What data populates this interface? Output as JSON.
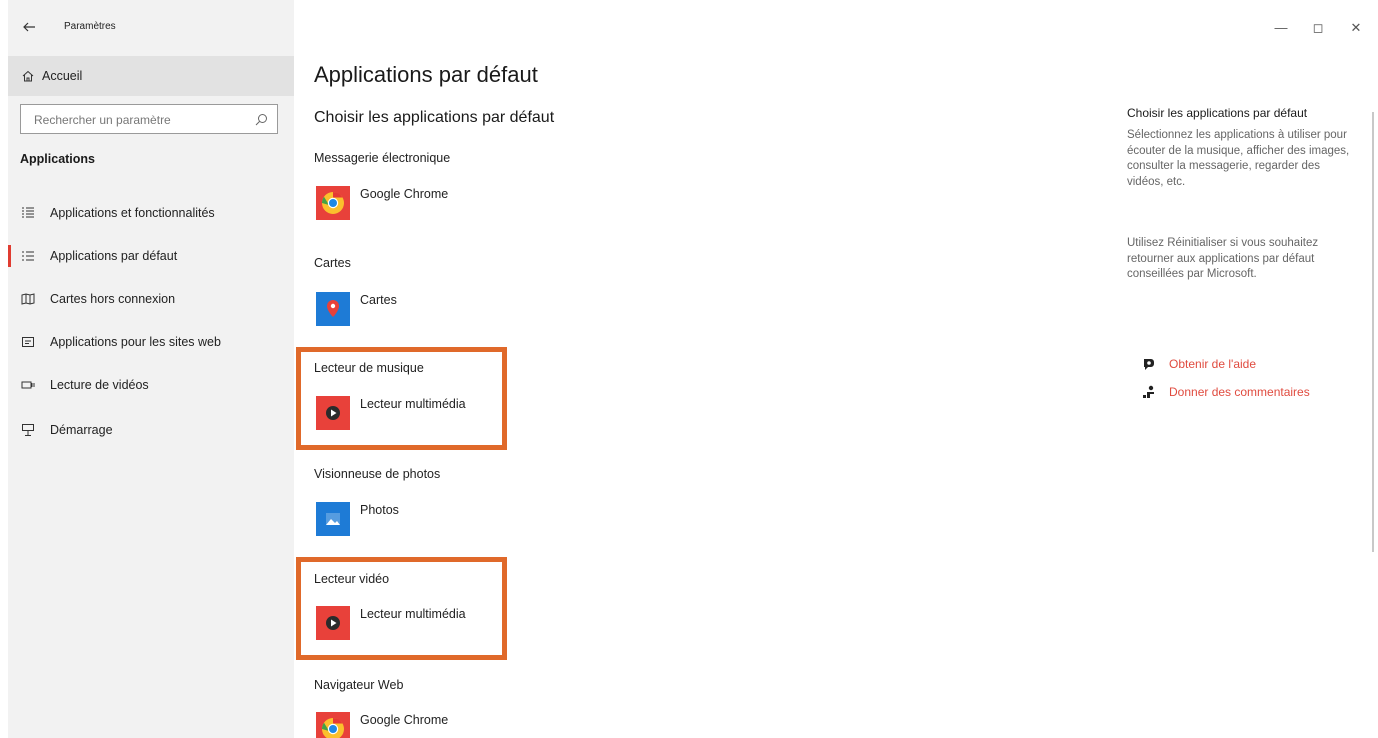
{
  "window": {
    "title": "Paramètres",
    "controls": {
      "minimize": "—",
      "maximize": "◻",
      "close": "✕"
    }
  },
  "sidebar": {
    "home_label": "Accueil",
    "search_placeholder": "Rechercher un paramètre",
    "section_title": "Applications",
    "items": [
      {
        "label": "Applications et fonctionnalités",
        "icon": "apps-features-icon",
        "active": false
      },
      {
        "label": "Applications par défaut",
        "icon": "default-apps-icon",
        "active": true
      },
      {
        "label": "Cartes hors connexion",
        "icon": "offline-maps-icon",
        "active": false
      },
      {
        "label": "Applications pour les sites web",
        "icon": "apps-for-websites-icon",
        "active": false
      },
      {
        "label": "Lecture de vidéos",
        "icon": "video-playback-icon",
        "active": false
      },
      {
        "label": "Démarrage",
        "icon": "startup-icon",
        "active": false
      }
    ]
  },
  "main": {
    "title": "Applications par défaut",
    "subtitle": "Choisir les applications par défaut",
    "categories": [
      {
        "label": "Messagerie électronique",
        "app": "Google Chrome",
        "icon": "chrome-icon"
      },
      {
        "label": "Cartes",
        "app": "Cartes",
        "icon": "maps-icon"
      },
      {
        "label": "Lecteur de musique",
        "app": "Lecteur multimédia",
        "icon": "media-player-icon",
        "highlighted": true
      },
      {
        "label": "Visionneuse de photos",
        "app": "Photos",
        "icon": "photos-icon"
      },
      {
        "label": "Lecteur vidéo",
        "app": "Lecteur multimédia",
        "icon": "media-player-icon",
        "highlighted": true
      },
      {
        "label": "Navigateur Web",
        "app": "Google Chrome",
        "icon": "chrome-icon"
      }
    ]
  },
  "right_panel": {
    "title": "Choisir les applications par défaut",
    "paragraph1": "Sélectionnez les applications à utiliser pour écouter de la musique, afficher des images, consulter la messagerie, regarder des vidéos, etc.",
    "paragraph2": "Utilisez Réinitialiser si vous souhaitez retourner aux applications par défaut conseillées par Microsoft.",
    "links": [
      {
        "label": "Obtenir de l'aide",
        "icon": "help-icon"
      },
      {
        "label": "Donner des commentaires",
        "icon": "feedback-icon"
      }
    ]
  },
  "colors": {
    "accent": "#e03c31",
    "highlight_border": "#e0692a",
    "link": "#e04b3f",
    "sidebar_bg": "#f2f2f2"
  }
}
